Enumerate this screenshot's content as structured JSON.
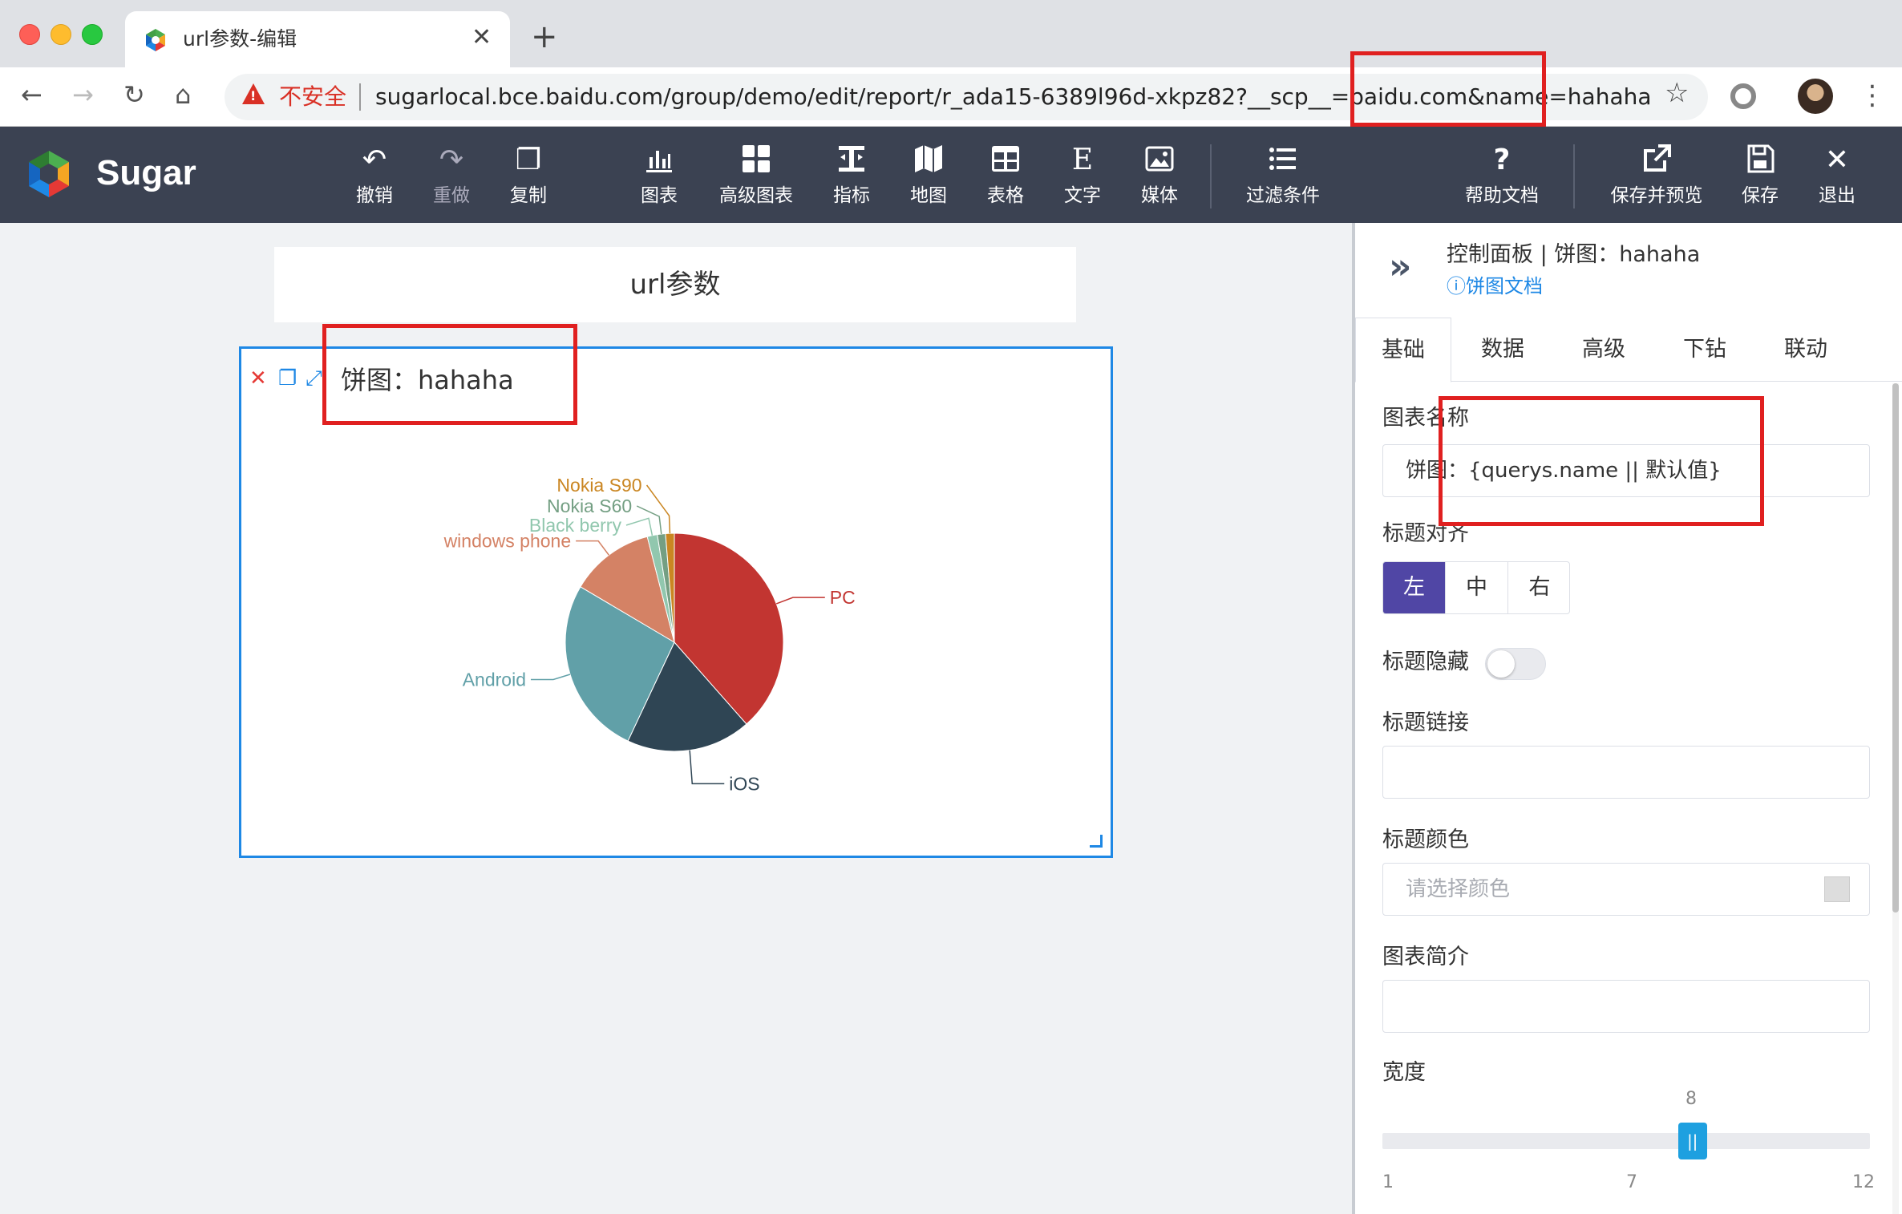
{
  "browser": {
    "tab_title": "url参数-编辑",
    "insecure_label": "不安全",
    "url": "sugarlocal.bce.baidu.com/group/demo/edit/report/r_ada15-6389l96d-xkpz82?__scp__=baidu.com&name=hahaha"
  },
  "app": {
    "brand": "Sugar",
    "toolbar": {
      "undo": "撤销",
      "redo": "重做",
      "copy": "复制",
      "chart": "图表",
      "advanced_chart": "高级图表",
      "metric": "指标",
      "map": "地图",
      "table": "表格",
      "text": "文字",
      "media": "媒体",
      "filter": "过滤条件",
      "help": "帮助文档",
      "save_preview": "保存并预览",
      "save": "保存",
      "exit": "退出"
    }
  },
  "canvas": {
    "report_title": "url参数",
    "widget_title": "饼图：hahaha"
  },
  "chart_data": {
    "type": "pie",
    "title": "饼图：hahaha",
    "slices": [
      {
        "name": "PC",
        "value": 38.5,
        "color": "#c23531"
      },
      {
        "name": "iOS",
        "value": 18.5,
        "color": "#2f4554"
      },
      {
        "name": "Android",
        "value": 26.5,
        "color": "#61a0a8"
      },
      {
        "name": "windows phone",
        "value": 12.5,
        "color": "#d48265"
      },
      {
        "name": "Black berry",
        "value": 1.5,
        "color": "#91c7ae"
      },
      {
        "name": "Nokia S60",
        "value": 1.2,
        "color": "#749f83"
      },
      {
        "name": "Nokia S90",
        "value": 1.3,
        "color": "#ca8622"
      }
    ]
  },
  "panel": {
    "title": "控制面板 | 饼图：hahaha",
    "doc_link": "ⓘ饼图文档",
    "tabs": [
      "基础",
      "数据",
      "高级",
      "下钻",
      "联动"
    ],
    "active_tab": "基础",
    "chart_name_label": "图表名称",
    "chart_name_value": "饼图：{querys.name || 默认值}",
    "title_align_label": "标题对齐",
    "align_options": [
      "左",
      "中",
      "右"
    ],
    "align_selected": "左",
    "title_hide_label": "标题隐藏",
    "title_hide_on": false,
    "title_link_label": "标题链接",
    "title_link_value": "",
    "title_color_label": "标题颜色",
    "title_color_placeholder": "请选择颜色",
    "chart_intro_label": "图表简介",
    "chart_intro_value": "",
    "width_label": "宽度",
    "width_value": "8",
    "width_min": "1",
    "width_mid": "7",
    "width_max": "12",
    "width_fraction": 0.636
  },
  "colors": {
    "appbar": "#3b4252",
    "accent": "#1e88e5",
    "highlight": "#e02020",
    "align_active": "#5046a5"
  }
}
